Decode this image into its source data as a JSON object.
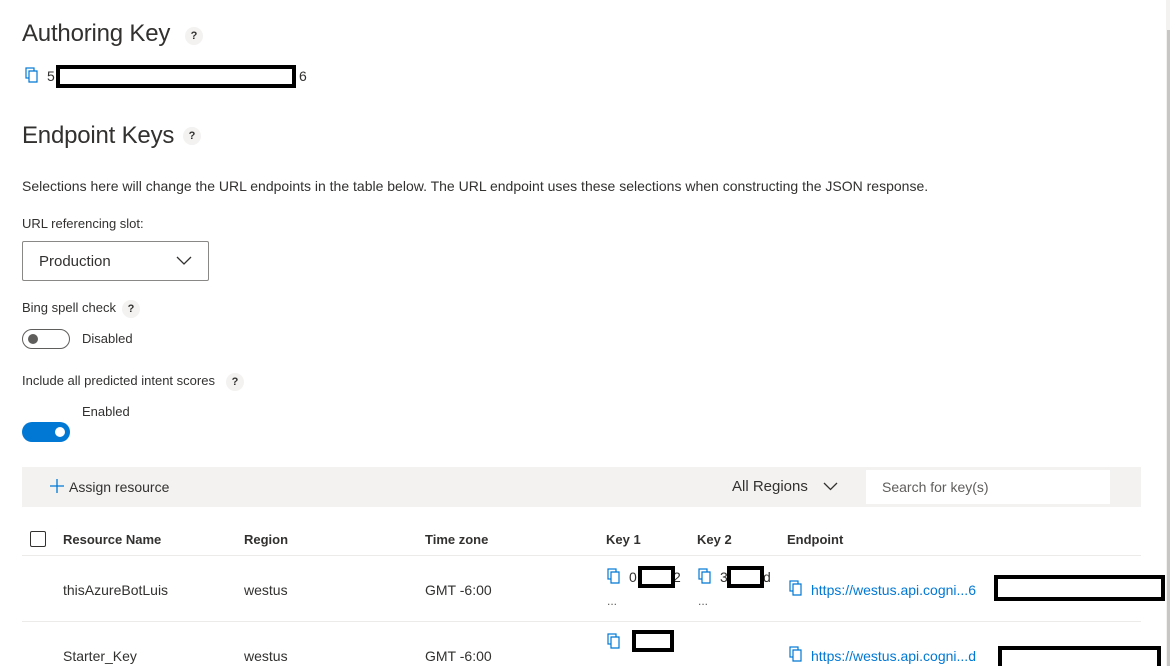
{
  "authoring": {
    "title": "Authoring Key",
    "help": "?",
    "key_prefix": "5",
    "key_suffix": "6"
  },
  "endpoint_keys": {
    "title": "Endpoint Keys",
    "help": "?",
    "description": "Selections here will change the URL endpoints in the table below. The URL endpoint uses these selections when constructing the JSON response.",
    "slot_label": "URL referencing slot:",
    "slot_value": "Production",
    "bing_label": "Bing spell check",
    "bing_state": "Disabled",
    "intent_label": "Include all predicted intent scores",
    "intent_state": "Enabled"
  },
  "toolbar": {
    "assign_label": "Assign resource",
    "region_filter": "All Regions",
    "search_placeholder": "Search for key(s)"
  },
  "table": {
    "columns": [
      "Resource Name",
      "Region",
      "Time zone",
      "Key 1",
      "Key 2",
      "Endpoint"
    ],
    "rows": [
      {
        "name": "thisAzureBotLuis",
        "region": "westus",
        "timezone": "GMT -6:00",
        "key1_prefix": "0",
        "key1_suffix": "2",
        "key2_prefix": "3",
        "key2_suffix": "d",
        "more": "...",
        "endpoint": "https://westus.api.cogni...6"
      },
      {
        "name": "Starter_Key",
        "region": "westus",
        "timezone": "GMT -6:00",
        "key1_prefix": "",
        "key1_suffix": "",
        "endpoint": "https://westus.api.cogni...d"
      }
    ]
  },
  "colors": {
    "accent": "#0078d4",
    "text": "#323130",
    "command_bar": "#f3f2f1"
  }
}
